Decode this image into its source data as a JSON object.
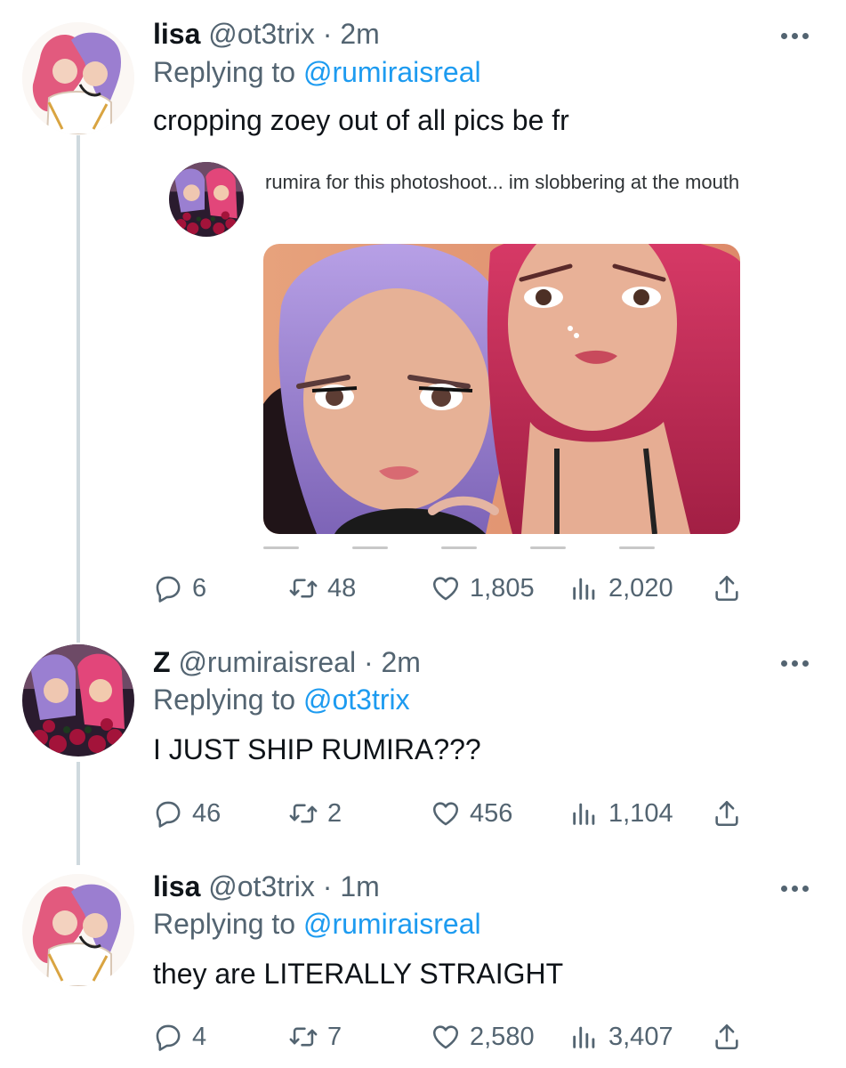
{
  "tweets": [
    {
      "name": "lisa",
      "handle": "@ot3trix",
      "time": "· 2m",
      "replying_prefix": "Replying to",
      "replying_handle": "@rumiraisreal",
      "text": "cropping zoey out of all pics be fr",
      "embedded_text": "rumira for this photoshoot... im slobbering at the mouth",
      "replies": "6",
      "retweets": "48",
      "likes": "1,805",
      "views": "2,020"
    },
    {
      "name": "Z",
      "handle": "@rumiraisreal",
      "time": "· 2m",
      "replying_prefix": "Replying to",
      "replying_handle": "@ot3trix",
      "text": "I JUST SHIP RUMIRA???",
      "replies": "46",
      "retweets": "2",
      "likes": "456",
      "views": "1,104"
    },
    {
      "name": "lisa",
      "handle": "@ot3trix",
      "time": "· 1m",
      "replying_prefix": "Replying to",
      "replying_handle": "@rumiraisreal",
      "text": "they are LITERALLY STRAIGHT",
      "replies": "4",
      "retweets": "7",
      "likes": "2,580",
      "views": "3,407"
    }
  ],
  "icons": {
    "reply": "reply-icon",
    "retweet": "retweet-icon",
    "like": "heart-icon",
    "views": "views-icon",
    "share": "share-icon",
    "more": "more-options-icon"
  },
  "colors": {
    "link": "#1d9bf0",
    "muted": "#536471",
    "text": "#0f1419",
    "thread_line": "#cfd9de"
  }
}
